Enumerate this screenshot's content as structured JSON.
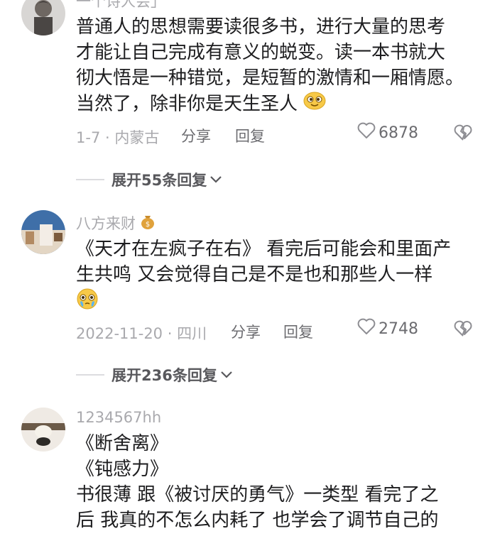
{
  "comments": [
    {
      "username": "一个诗人会」",
      "lines": [
        "普通人的思想需要读很多书，进行大量的思考",
        "才能让自己完成有意义的蜕变。读一本书就大",
        "彻大悟是一种错觉，是短暂的激情和一厢情愿。",
        "当然了，除非你是天生圣人"
      ],
      "emoji": "smiling-face-emoji",
      "meta": "1-7 · 内蒙古",
      "share": "分享",
      "reply": "回复",
      "likes": "6878",
      "expand": "展开55条回复"
    },
    {
      "username": "八方来财",
      "username_emoji": "money-bag-emoji",
      "lines": [
        "《天才在左疯子在右》 看完后可能会和里面产",
        "生共鸣 又会觉得自己是不是也和那些人一样"
      ],
      "emoji": "teary-face-emoji",
      "meta": "2022-11-20 · 四川",
      "share": "分享",
      "reply": "回复",
      "likes": "2748",
      "expand": "展开236条回复"
    },
    {
      "username": "1234567hh",
      "lines": [
        "《断舍离》",
        "《钝感力》",
        "书很薄 跟《被讨厌的勇气》一类型 看完了之",
        "后 我真的不怎么内耗了 也学会了调节自己的"
      ]
    }
  ]
}
